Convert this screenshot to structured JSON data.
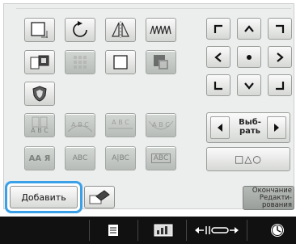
{
  "colors": {
    "highlight": "#3aa0e8",
    "arrow_dark": "#1a1a1a",
    "footer_bg": "#111111"
  },
  "tools_row1": [
    {
      "name": "frame-resize-icon"
    },
    {
      "name": "rotate-icon"
    },
    {
      "name": "mirror-icon"
    },
    {
      "name": "density-icon"
    }
  ],
  "tools_row2": [
    {
      "name": "border-icon"
    },
    {
      "name": "grid-icon"
    },
    {
      "name": "outline-icon"
    },
    {
      "name": "color-icon"
    }
  ],
  "tools_row3": [
    {
      "name": "shield-icon"
    }
  ],
  "text_tools": [
    {
      "name": "vertical-text-icon",
      "label_top": "",
      "label_bottom": "A B C"
    },
    {
      "name": "arc-text-icon",
      "label": "A B C"
    },
    {
      "name": "spacing-text-icon",
      "label": "A B C"
    },
    {
      "name": "wave-text-icon",
      "label": "A B C"
    }
  ],
  "font_tools": [
    {
      "name": "font-case-icon",
      "label": "AA Я"
    },
    {
      "name": "font-abc-1-icon",
      "label": "ABC"
    },
    {
      "name": "font-abc-2-icon",
      "label": "A|BC"
    },
    {
      "name": "font-abc-3-icon",
      "label": "ABC"
    }
  ],
  "selector": {
    "label": "Выб-рать",
    "shapes": "□△○"
  },
  "buttons": {
    "add": "Добавить",
    "end_edit": "Окончание Редакти- рования"
  },
  "footer": {
    "icons": [
      "document-icon",
      "chart-icon",
      "width-icon",
      "clock-icon"
    ]
  }
}
